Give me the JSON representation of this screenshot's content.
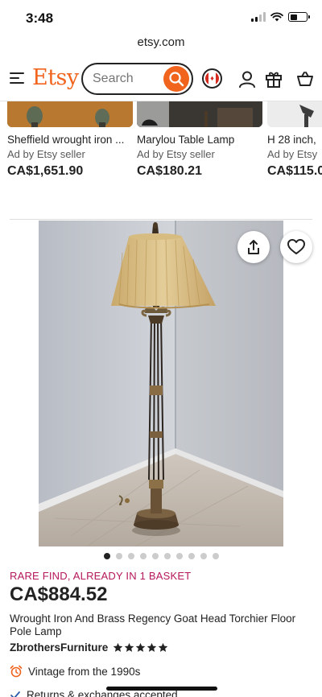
{
  "status": {
    "time": "3:48",
    "battery_level": 0.45
  },
  "browser": {
    "url": "etsy.com"
  },
  "header": {
    "logo": "Etsy",
    "search_placeholder": "Search"
  },
  "carousel": [
    {
      "title": "Sheffield wrought iron ...",
      "ad": "Ad by Etsy seller",
      "price": "CA$1,651.90"
    },
    {
      "title": "Marylou Table Lamp",
      "ad": "Ad by Etsy seller",
      "price": "CA$180.21"
    },
    {
      "title": "H 28 inch,",
      "ad": "Ad by Etsy",
      "price": "CA$115.0"
    }
  ],
  "listing": {
    "image_count": 10,
    "active_image": 0,
    "badge": "RARE FIND, ALREADY IN 1 BASKET",
    "price": "CA$884.52",
    "title": "Wrought Iron And Brass Regency Goat Head Torchier Floor Pole Lamp",
    "shop": "ZbrothersFurniture",
    "rating_stars": 5,
    "vintage": "Vintage from the 1990s",
    "returns": "Returns & exchanges accepted"
  },
  "colors": {
    "brand": "#f1641e",
    "badge": "#b5175b",
    "star": "#222222"
  },
  "icons": [
    "menu-icon",
    "search-icon",
    "canada-flag-icon",
    "account-icon",
    "gift-icon",
    "cart-icon",
    "share-icon",
    "heart-icon",
    "alarm-clock-icon",
    "check-icon",
    "star-icon"
  ]
}
